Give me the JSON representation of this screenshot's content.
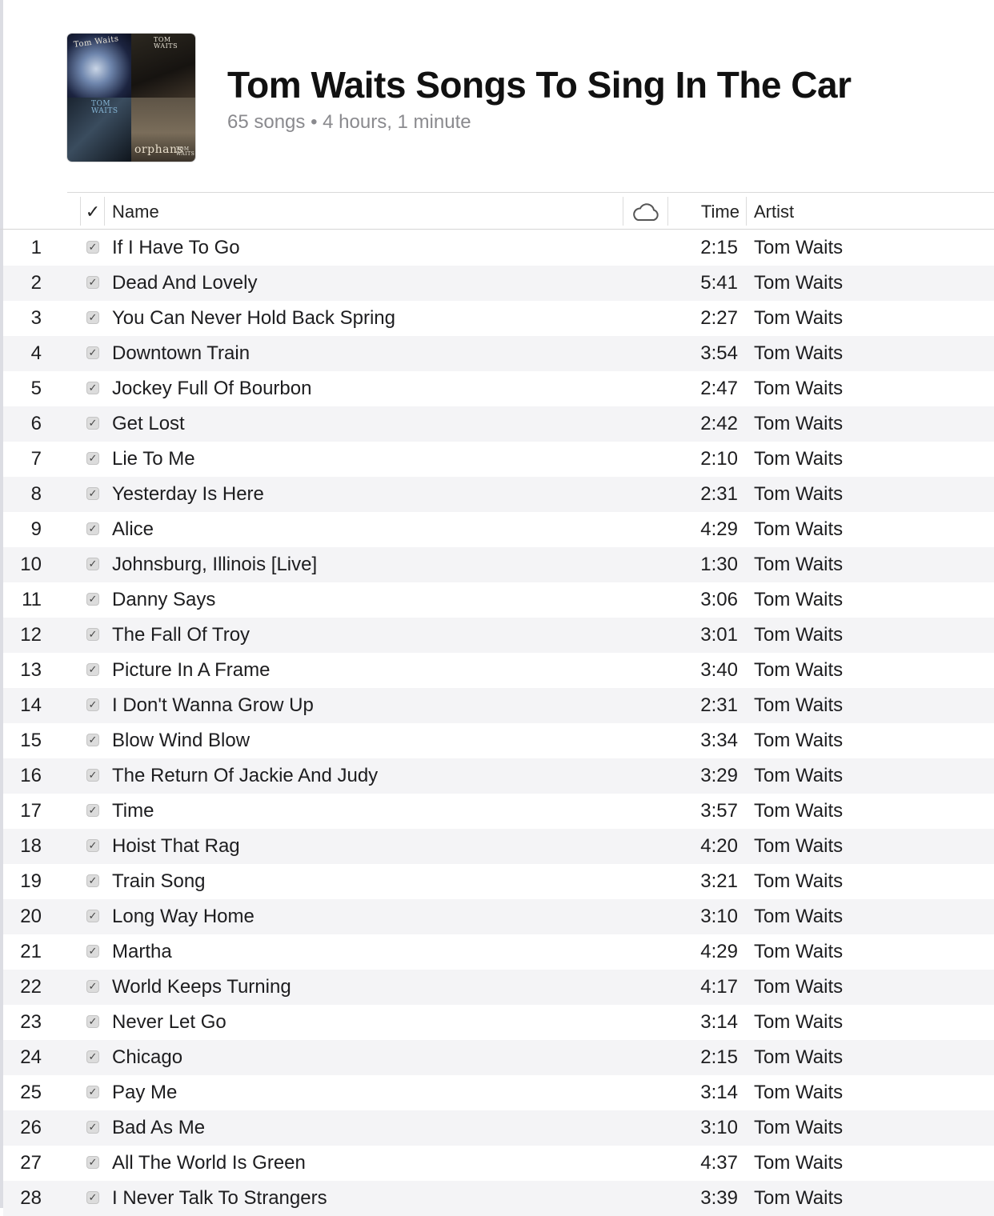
{
  "playlist": {
    "title": "Tom Waits Songs To Sing In The Car",
    "subtitle": "65 songs • 4 hours, 1 minute",
    "artwork": {
      "q1_text": "Tom Waits",
      "q2_text": "TOM WAITS",
      "q3_text": "TOM WAITS",
      "q4_text_main": "orphans",
      "q4_text_small": "TOM WAITS"
    }
  },
  "columns": {
    "check": "✓",
    "name": "Name",
    "cloud_icon": "cloud-icon",
    "time": "Time",
    "artist": "Artist"
  },
  "checkbox_glyph": "✓",
  "rows": [
    {
      "num": "1",
      "name": "If I Have To Go",
      "time": "2:15",
      "artist": "Tom Waits"
    },
    {
      "num": "2",
      "name": "Dead And Lovely",
      "time": "5:41",
      "artist": "Tom Waits"
    },
    {
      "num": "3",
      "name": "You Can Never Hold Back Spring",
      "time": "2:27",
      "artist": "Tom Waits"
    },
    {
      "num": "4",
      "name": "Downtown Train",
      "time": "3:54",
      "artist": "Tom Waits"
    },
    {
      "num": "5",
      "name": "Jockey Full Of Bourbon",
      "time": "2:47",
      "artist": "Tom Waits"
    },
    {
      "num": "6",
      "name": "Get Lost",
      "time": "2:42",
      "artist": "Tom Waits"
    },
    {
      "num": "7",
      "name": "Lie To Me",
      "time": "2:10",
      "artist": "Tom Waits"
    },
    {
      "num": "8",
      "name": "Yesterday Is Here",
      "time": "2:31",
      "artist": "Tom Waits"
    },
    {
      "num": "9",
      "name": "Alice",
      "time": "4:29",
      "artist": "Tom Waits"
    },
    {
      "num": "10",
      "name": "Johnsburg, Illinois [Live]",
      "time": "1:30",
      "artist": "Tom Waits"
    },
    {
      "num": "11",
      "name": "Danny Says",
      "time": "3:06",
      "artist": "Tom Waits"
    },
    {
      "num": "12",
      "name": "The Fall Of Troy",
      "time": "3:01",
      "artist": "Tom Waits"
    },
    {
      "num": "13",
      "name": "Picture In A Frame",
      "time": "3:40",
      "artist": "Tom Waits"
    },
    {
      "num": "14",
      "name": "I Don't Wanna Grow Up",
      "time": "2:31",
      "artist": "Tom Waits"
    },
    {
      "num": "15",
      "name": "Blow Wind Blow",
      "time": "3:34",
      "artist": "Tom Waits"
    },
    {
      "num": "16",
      "name": "The Return Of Jackie And Judy",
      "time": "3:29",
      "artist": "Tom Waits"
    },
    {
      "num": "17",
      "name": "Time",
      "time": "3:57",
      "artist": "Tom Waits"
    },
    {
      "num": "18",
      "name": "Hoist That Rag",
      "time": "4:20",
      "artist": "Tom Waits"
    },
    {
      "num": "19",
      "name": "Train Song",
      "time": "3:21",
      "artist": "Tom Waits"
    },
    {
      "num": "20",
      "name": "Long Way Home",
      "time": "3:10",
      "artist": "Tom Waits"
    },
    {
      "num": "21",
      "name": "Martha",
      "time": "4:29",
      "artist": "Tom Waits"
    },
    {
      "num": "22",
      "name": "World Keeps Turning",
      "time": "4:17",
      "artist": "Tom Waits"
    },
    {
      "num": "23",
      "name": "Never Let Go",
      "time": "3:14",
      "artist": "Tom Waits"
    },
    {
      "num": "24",
      "name": "Chicago",
      "time": "2:15",
      "artist": "Tom Waits"
    },
    {
      "num": "25",
      "name": "Pay Me",
      "time": "3:14",
      "artist": "Tom Waits"
    },
    {
      "num": "26",
      "name": "Bad As Me",
      "time": "3:10",
      "artist": "Tom Waits"
    },
    {
      "num": "27",
      "name": "All The World Is Green",
      "time": "4:37",
      "artist": "Tom Waits"
    },
    {
      "num": "28",
      "name": "I Never Talk To Strangers",
      "time": "3:39",
      "artist": "Tom Waits"
    }
  ]
}
